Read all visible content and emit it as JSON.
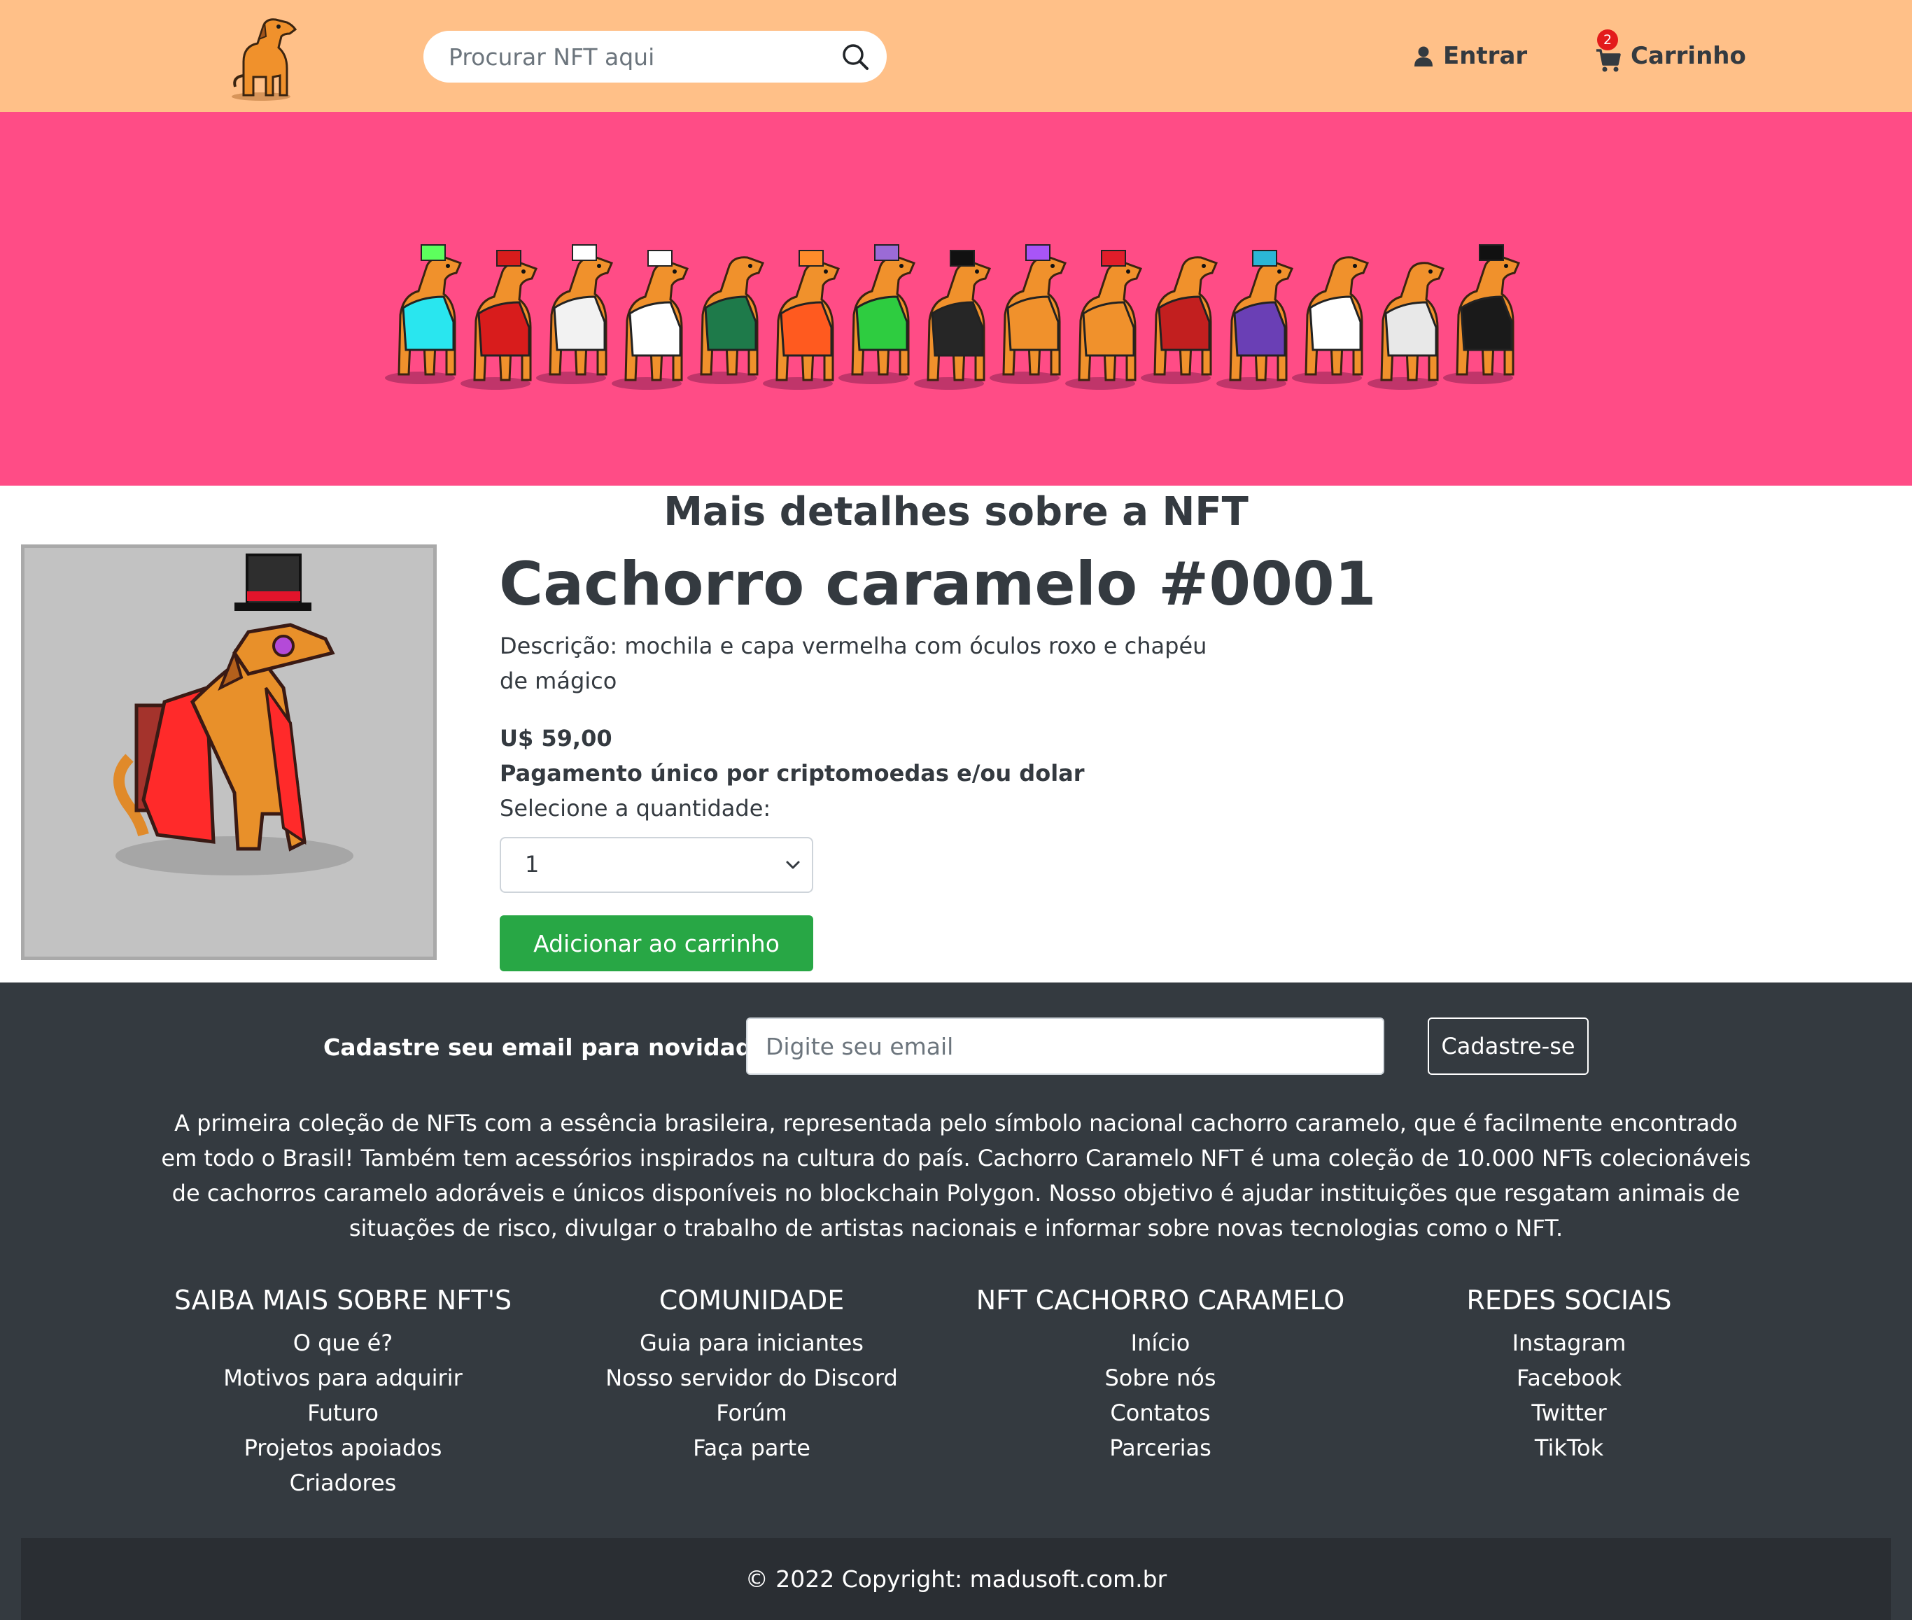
{
  "header": {
    "logo_icon": "caramel-dog-logo",
    "search": {
      "placeholder": "Procurar NFT aqui",
      "icon": "search-icon"
    },
    "login": {
      "label": "Entrar",
      "icon": "user-icon"
    },
    "cart": {
      "label": "Carrinho",
      "count": "2",
      "icon": "cart-icon"
    }
  },
  "banner": {
    "background": "#ff4c86"
  },
  "details": {
    "section_title": "Mais detalhes sobre a NFT",
    "title": "Cachorro caramelo #0001",
    "description": "Descrição: mochila e capa vermelha com óculos roxo e chapéu de mágico",
    "price": "U$ 59,00",
    "payment": "Pagamento único por criptomoedas e/ou dolar",
    "quantity_label": "Selecione a quantidade:",
    "quantity_value": "1",
    "add_button": "Adicionar ao carrinho"
  },
  "footer": {
    "newsletter_label": "Cadastre seu email para novidades",
    "email_placeholder": "Digite seu email",
    "signup_button": "Cadastre-se",
    "about": "A primeira coleção de NFTs com a essência brasileira, representada pelo símbolo nacional cachorro caramelo, que é facilmente encontrado em todo o Brasil! Também tem acessórios inspirados na cultura do país. Cachorro Caramelo NFT é uma coleção de 10.000 NFTs colecionáveis de cachorros caramelo adoráveis e únicos disponíveis no blockchain Polygon. Nosso objetivo é ajudar instituições que resgatam animais de situações de risco, divulgar o trabalho de artistas nacionais e informar sobre novas tecnologias como o NFT.",
    "columns": [
      {
        "title": "SAIBA MAIS SOBRE NFT'S",
        "links": [
          "O que é?",
          "Motivos para adquirir",
          "Futuro",
          "Projetos apoiados",
          "Criadores"
        ]
      },
      {
        "title": "COMUNIDADE",
        "links": [
          "Guia para iniciantes",
          "Nosso servidor do Discord",
          "Forúm",
          "Faça parte"
        ]
      },
      {
        "title": "NFT CACHORRO CARAMELO",
        "links": [
          "Início",
          "Sobre nós",
          "Contatos",
          "Parcerias"
        ]
      },
      {
        "title": "REDES SOCIAIS",
        "links": [
          "Instagram",
          "Facebook",
          "Twitter",
          "TikTok"
        ]
      }
    ],
    "copyright": "© 2022 Copyright: madusoft.com.br"
  },
  "colors": {
    "header_bg": "#ffc088",
    "banner_bg": "#ff4c86",
    "footer_bg": "#343a40",
    "button_green": "#28a745",
    "badge_red": "#e31b1b"
  }
}
